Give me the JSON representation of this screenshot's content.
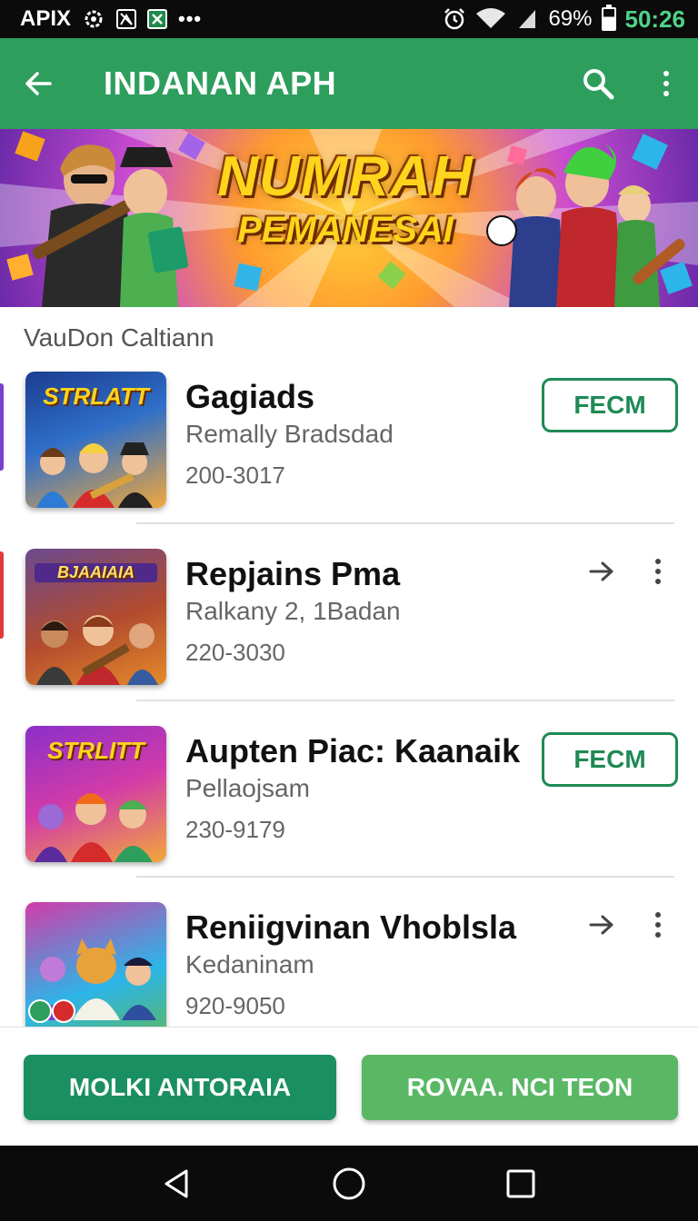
{
  "status_bar": {
    "carrier": "APIX",
    "left_icons": [
      "settings-gear-icon",
      "image-icon",
      "excel-icon",
      "more-dots-icon"
    ],
    "battery_percent": "69%",
    "time": "50:26"
  },
  "app_bar": {
    "title": "INDANAN APH",
    "back_icon": "arrow-left-icon",
    "search_icon": "search-icon",
    "menu_icon": "more-vert-icon",
    "color": "#2e9e5d"
  },
  "banner": {
    "title_line1": "NUMRAH",
    "title_line2": "PEMANESAI"
  },
  "section": {
    "title": "VauDon Caltiann"
  },
  "items": [
    {
      "name": "Gagiads",
      "subtitle": "Remally Bradsdad",
      "meta": "200-3017",
      "action": "button",
      "action_label": "FECM",
      "thumb_label": "STRLATT",
      "side_color": "#7b3fd0"
    },
    {
      "name": "Repjains Pma",
      "subtitle": "Ralkany 2, 1Badan",
      "meta": "220-3030",
      "action": "arrow",
      "thumb_label": "BJAAIAIA",
      "side_color": "#e03a3a"
    },
    {
      "name": "Aupten Piac: Kaanaik",
      "subtitle": "Pellaojsam",
      "meta": "230-9179",
      "action": "button",
      "action_label": "FECM",
      "thumb_label": "STRLITT",
      "side_color": ""
    },
    {
      "name": "Reniigvinan Vhoblsla",
      "subtitle": "Kedaninam",
      "meta": "920-9050",
      "action": "arrow",
      "thumb_label": "",
      "side_color": ""
    }
  ],
  "bottom": {
    "primary_label": "MOLKI ANTORAIA",
    "secondary_label": "ROVAA. NCI TEON",
    "primary_color": "#1a8f62",
    "secondary_color": "#5ab865"
  },
  "nav_bar": {
    "back_icon": "nav-back-icon",
    "home_icon": "nav-home-icon",
    "recents_icon": "nav-recents-icon"
  }
}
